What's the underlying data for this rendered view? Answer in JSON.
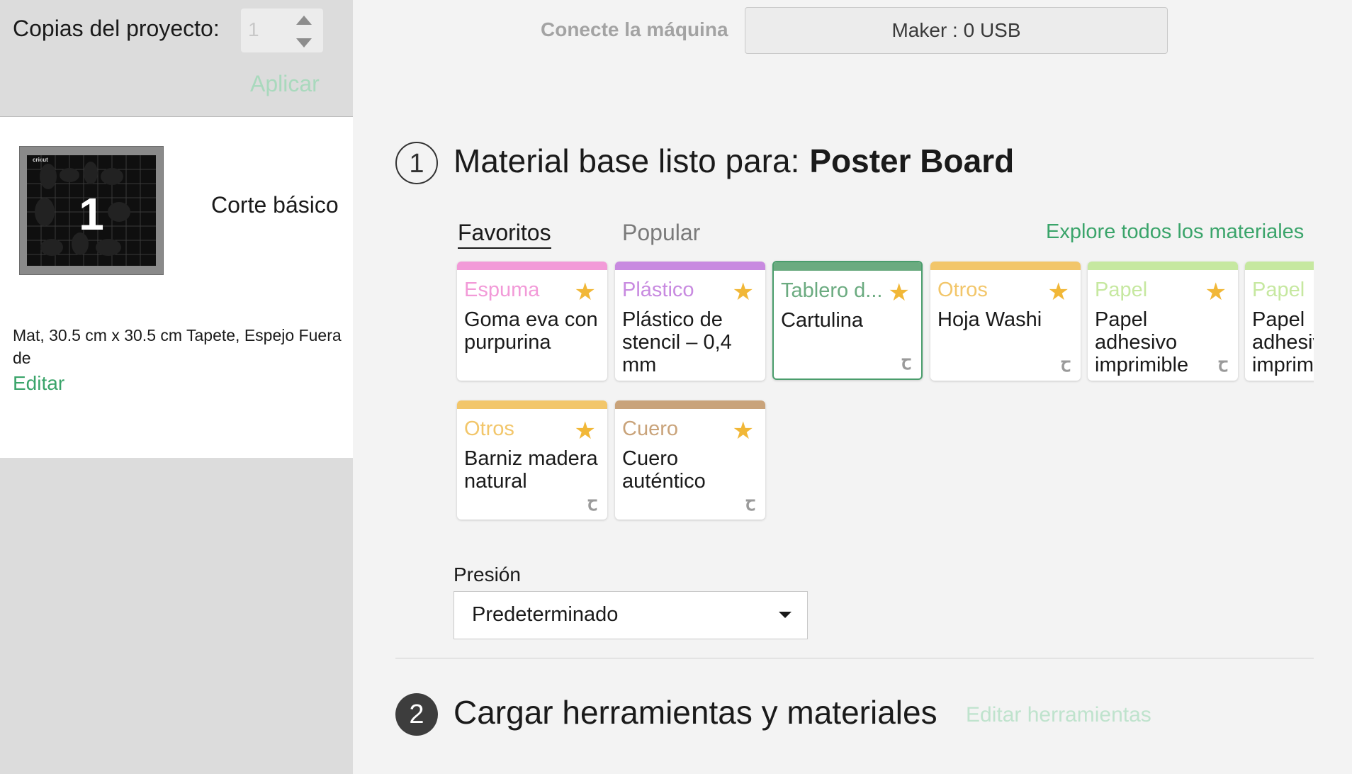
{
  "left_panel": {
    "copies_label": "Copias del proyecto:",
    "copies_value": "1",
    "apply_label": "Aplicar",
    "mat": {
      "brand": "cricut",
      "number": "1",
      "title": "Corte básico",
      "info": "Mat, 30.5 cm x 30.5 cm Tapete, Espejo Fuera de",
      "edit_label": "Editar"
    }
  },
  "top_bar": {
    "connect_label": "Conecte la máquina",
    "device_value": "Maker : 0 USB"
  },
  "section1": {
    "step": "1",
    "title_prefix": "Material base listo para:",
    "material": "Poster Board",
    "tabs": [
      "Favoritos",
      "Popular"
    ],
    "active_tab": "Favoritos",
    "explore_label": "Explore todos los materiales",
    "cards": [
      {
        "category": "Espuma",
        "name": "Goma eva con purpurina",
        "color": "#f29ad8",
        "favorite": true,
        "machine_icon": true
      },
      {
        "category": "Plástico",
        "name": "Plástico de stencil – 0,4 mm",
        "color": "#c88ae0",
        "favorite": true,
        "machine_icon": false
      },
      {
        "category": "Tablero d...",
        "name": "Cartulina",
        "color": "#6bab80",
        "favorite": true,
        "machine_icon": true,
        "selected": true
      },
      {
        "category": "Otros",
        "name": "Hoja Washi",
        "color": "#f2c66a",
        "favorite": true,
        "machine_icon": true
      },
      {
        "category": "Papel",
        "name": "Papel adhesivo imprimible",
        "color": "#c6e8a0",
        "favorite": true,
        "machine_icon": true
      },
      {
        "category": "Papel",
        "name": "Papel adhesivo imprimible",
        "color": "#c6e8a0",
        "favorite": true,
        "machine_icon": true
      },
      {
        "category": "Otros",
        "name": "Barniz madera natural",
        "color": "#f2c66a",
        "favorite": true,
        "machine_icon": true
      },
      {
        "category": "Cuero",
        "name": "Cuero auténtico",
        "color": "#c9a37a",
        "favorite": true,
        "machine_icon": true
      }
    ],
    "pressure": {
      "label": "Presión",
      "value": "Predeterminado"
    }
  },
  "section2": {
    "step": "2",
    "title": "Cargar herramientas y materiales",
    "edit_tools_label": "Editar herramientas"
  },
  "icons": {
    "star": "favorite-star-icon",
    "machine": "cricut-machine-icon",
    "caret": "chevron-down-icon"
  }
}
